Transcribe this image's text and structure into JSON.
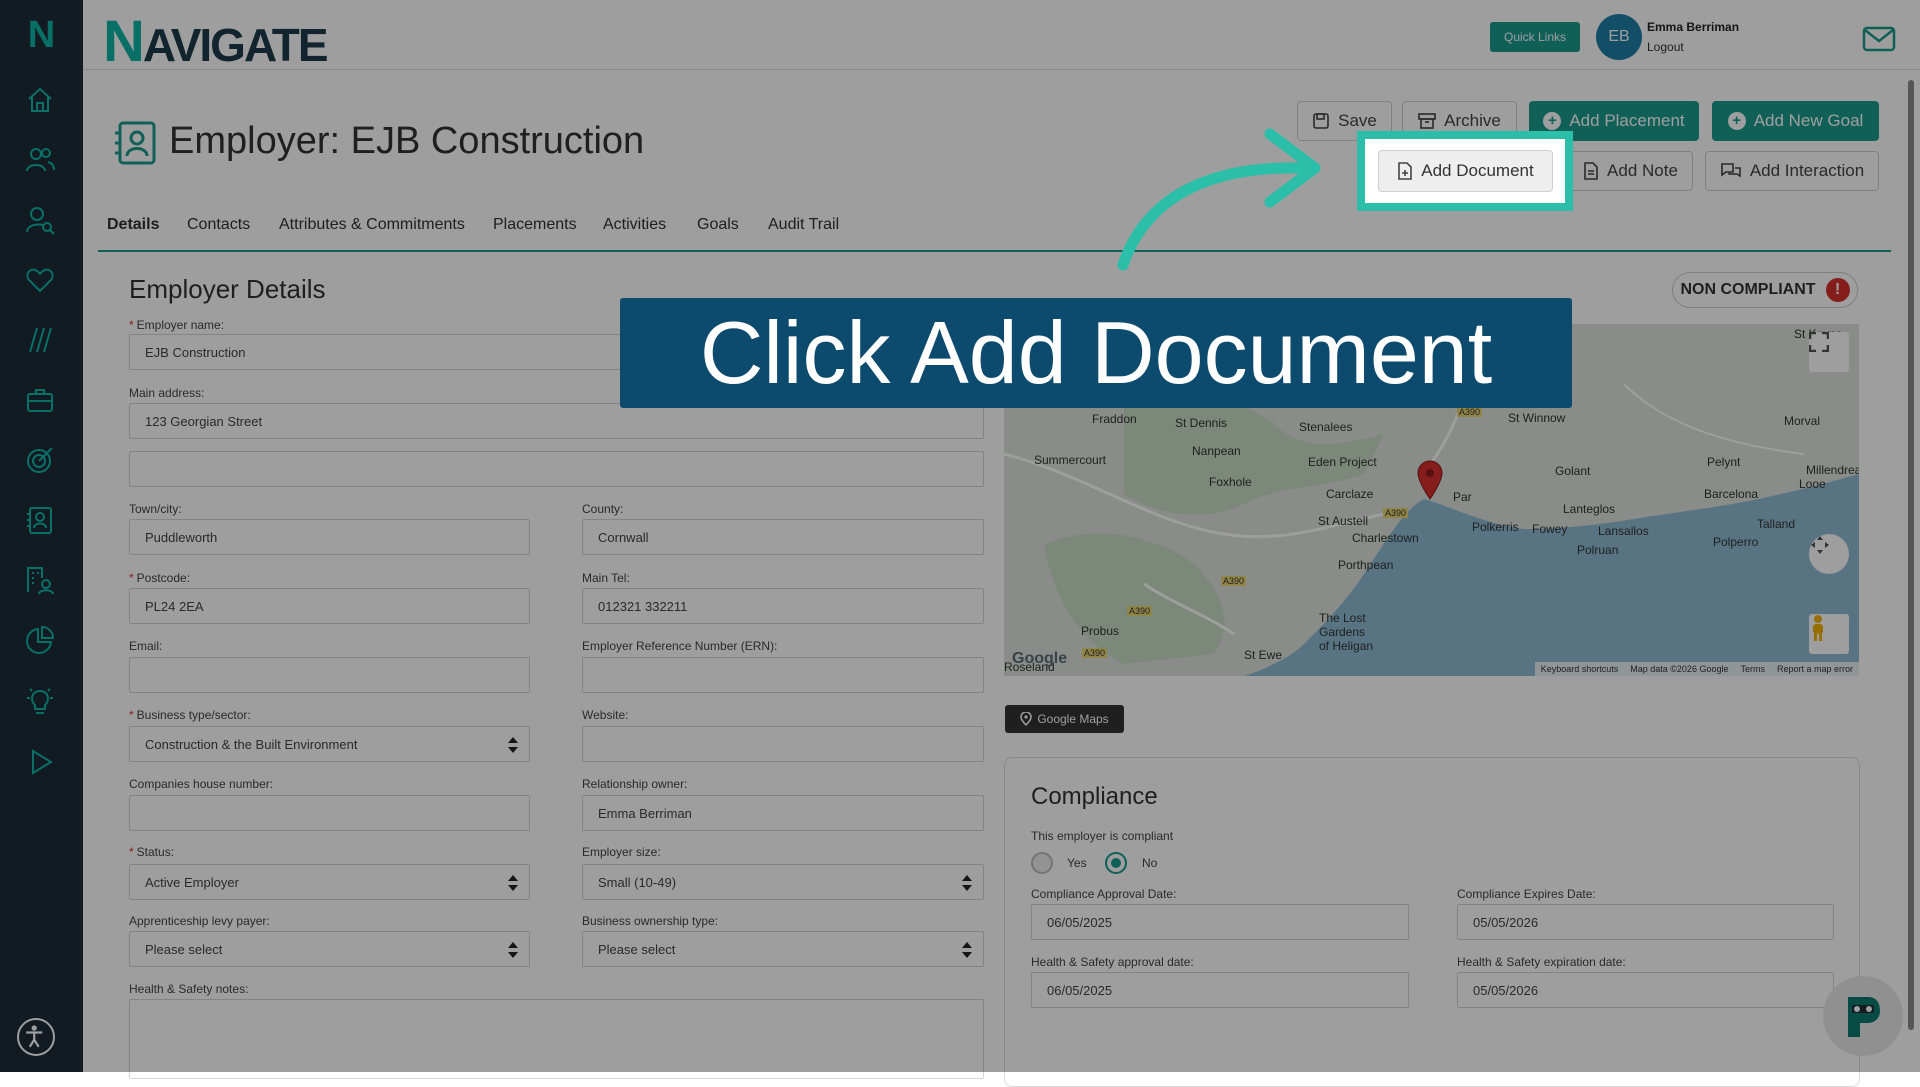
{
  "brand": {
    "logo_letter": "N",
    "name_initial": "N",
    "name_rest": "AVIGATE"
  },
  "topbar": {
    "quick_links": "Quick Links",
    "avatar_initials": "EB",
    "user_name": "Emma Berriman",
    "logout": "Logout"
  },
  "sidebar_icons": [
    "home-icon",
    "people-icon",
    "user-search-icon",
    "heart-icon",
    "slashes-icon",
    "briefcase-icon",
    "target-icon",
    "contact-card-icon",
    "building-user-icon",
    "pie-chart-icon",
    "lightbulb-icon",
    "play-icon"
  ],
  "page": {
    "title": "Employer: EJB Construction"
  },
  "actions": {
    "save": "Save",
    "archive": "Archive",
    "add_placement": "Add Placement",
    "add_new_goal": "Add New Goal",
    "add_document": "Add Document",
    "add_note": "Add Note",
    "add_interaction": "Add Interaction"
  },
  "tabs": [
    "Details",
    "Contacts",
    "Attributes & Commitments",
    "Placements",
    "Activities",
    "Goals",
    "Audit Trail"
  ],
  "employer_details": {
    "title": "Employer Details",
    "employer_name_label": "Employer name:",
    "employer_name": "EJB Construction",
    "main_address_label": "Main address:",
    "address_line1": "123 Georgian Street",
    "address_line2": "",
    "town_label": "Town/city:",
    "town": "Puddleworth",
    "county_label": "County:",
    "county": "Cornwall",
    "postcode_label": "Postcode:",
    "postcode": "PL24 2EA",
    "main_tel_label": "Main Tel:",
    "main_tel": "012321 332211",
    "email_label": "Email:",
    "email": "",
    "ern_label": "Employer Reference Number (ERN):",
    "ern": "",
    "business_type_label": "Business type/sector:",
    "business_type": "Construction & the Built Environment",
    "website_label": "Website:",
    "website": "",
    "companies_house_label": "Companies house number:",
    "companies_house": "",
    "relationship_owner_label": "Relationship owner:",
    "relationship_owner": "Emma Berriman",
    "status_label": "Status:",
    "status": "Active Employer",
    "employer_size_label": "Employer size:",
    "employer_size": "Small (10-49)",
    "levy_label": "Apprenticeship levy payer:",
    "levy": "Please select",
    "ownership_label": "Business ownership type:",
    "ownership": "Please select",
    "hs_notes_label": "Health & Safety notes:",
    "hs_notes": ""
  },
  "compliance_badge": {
    "text": "NON COMPLIANT",
    "icon": "!"
  },
  "map": {
    "labels": [
      "St Keyne",
      "Fraddon",
      "St Dennis",
      "Stenalees",
      "St Winnow",
      "Morval",
      "Summercourt",
      "Nanpean",
      "Eden Project",
      "Par",
      "Golant",
      "Pelynt",
      "Millendreath",
      "Looe",
      "Foxhole",
      "Carclaze",
      "Barcelona",
      "St Austell",
      "Lanteglos",
      "Talland",
      "Polkerris",
      "Fowey",
      "Lansallos",
      "Polperro",
      "Charlestown",
      "Polruan",
      "Porthpean",
      "The Lost",
      "Gardens",
      "of Heligan",
      "Probus",
      "St Ewe",
      "Roseland"
    ],
    "road_labels": [
      "A390",
      "A390",
      "A390",
      "A390",
      "A390"
    ],
    "google": "Google",
    "footer": [
      "Keyboard shortcuts",
      "Map data ©2026 Google",
      "Terms",
      "Report a map error"
    ],
    "button": "Google Maps"
  },
  "compliance": {
    "title": "Compliance",
    "compliant_label": "This employer is compliant",
    "yes": "Yes",
    "no": "No",
    "selected": "No",
    "approval_label": "Compliance Approval Date:",
    "approval": "06/05/2025",
    "expires_label": "Compliance Expires Date:",
    "expires": "05/05/2026",
    "hs_approval_label": "Health & Safety approval date:",
    "hs_approval": "06/05/2025",
    "hs_expiration_label": "Health & Safety expiration date:",
    "hs_expiration": "05/05/2026"
  },
  "tutorial": {
    "callout": "Click Add Document"
  },
  "colors": {
    "accent": "#1a9c8f",
    "sidebar": "#1e2b38",
    "callout": "#0c4a6e",
    "highlight": "#2bbfa9",
    "alert": "#d9302f"
  }
}
